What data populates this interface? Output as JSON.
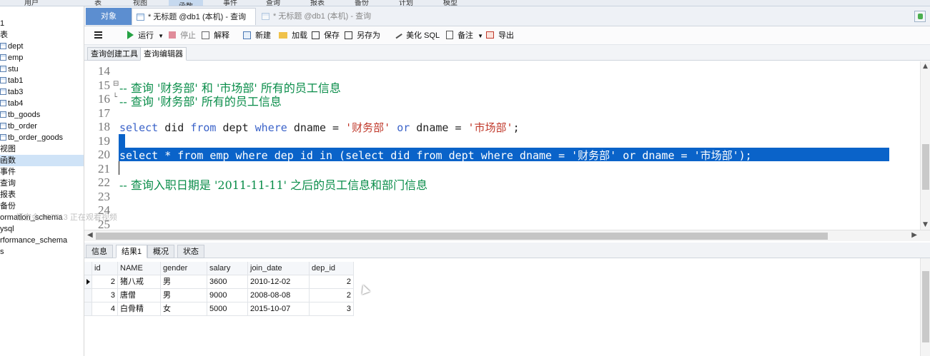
{
  "top_menu": [
    "用户",
    "表",
    "视图",
    "函数",
    "事件",
    "查询",
    "报表",
    "备份",
    "计划",
    "模型"
  ],
  "top_menu_active_index": 3,
  "tabs": {
    "objects_label": "对象",
    "active_tab": "* 无标题 @db1 (本机) - 查询",
    "inactive_tab": "* 无标题 @db1 (本机) - 查询"
  },
  "sidebar": {
    "items": [
      {
        "label": "1",
        "indent": 0,
        "icon": false
      },
      {
        "label": "表",
        "indent": 0,
        "icon": false
      },
      {
        "label": "dept",
        "indent": 1,
        "icon": true
      },
      {
        "label": "emp",
        "indent": 1,
        "icon": true
      },
      {
        "label": "stu",
        "indent": 1,
        "icon": true
      },
      {
        "label": "tab1",
        "indent": 1,
        "icon": true
      },
      {
        "label": "tab3",
        "indent": 1,
        "icon": true
      },
      {
        "label": "tab4",
        "indent": 1,
        "icon": true
      },
      {
        "label": "tb_goods",
        "indent": 1,
        "icon": true
      },
      {
        "label": "tb_order",
        "indent": 1,
        "icon": true
      },
      {
        "label": "tb_order_goods",
        "indent": 1,
        "icon": true
      },
      {
        "label": "视图",
        "indent": 0,
        "icon": false
      },
      {
        "label": "函数",
        "indent": 0,
        "icon": false,
        "selected": true
      },
      {
        "label": "事件",
        "indent": 0,
        "icon": false
      },
      {
        "label": "查询",
        "indent": 0,
        "icon": false
      },
      {
        "label": "报表",
        "indent": 0,
        "icon": false
      },
      {
        "label": "备份",
        "indent": 0,
        "icon": false
      },
      {
        "label": "ormation_schema",
        "indent": 0,
        "icon": false
      },
      {
        "label": "ysql",
        "indent": 0,
        "icon": false
      },
      {
        "label": "rformance_schema",
        "indent": 0,
        "icon": false
      },
      {
        "label": "s",
        "indent": 0,
        "icon": false
      }
    ],
    "watermark": "悟空会 987713 正在观看视频"
  },
  "toolbar": {
    "run": "运行",
    "stop": "停止",
    "explain": "解释",
    "new": "新建",
    "load": "加载",
    "save": "保存",
    "save_as": "另存为",
    "beautify": "美化 SQL",
    "comment": "备注",
    "export": "导出"
  },
  "subtabs": {
    "builder": "查询创建工具",
    "editor": "查询编辑器"
  },
  "editor": {
    "lines": [
      {
        "n": "14",
        "parts": []
      },
      {
        "n": "15",
        "parts": [
          {
            "t": "-- 查询 '财务部' 和 '市场部' 所有的员工信息",
            "c": "cm"
          }
        ],
        "fold": "⊟"
      },
      {
        "n": "16",
        "parts": [
          {
            "t": "-- 查询 '财务部' 所有的员工信息",
            "c": "cm"
          }
        ],
        "fold": "└"
      },
      {
        "n": "17",
        "parts": []
      },
      {
        "n": "18",
        "parts": [
          {
            "t": "select",
            "c": "kw"
          },
          {
            "t": " did ",
            "c": "pl"
          },
          {
            "t": "from",
            "c": "kw"
          },
          {
            "t": " dept ",
            "c": "pl"
          },
          {
            "t": "where",
            "c": "kw"
          },
          {
            "t": " dname = ",
            "c": "pl"
          },
          {
            "t": "'财务部'",
            "c": "st"
          },
          {
            "t": " ",
            "c": "pl"
          },
          {
            "t": "or",
            "c": "kw"
          },
          {
            "t": " dname = ",
            "c": "pl"
          },
          {
            "t": "'市场部'",
            "c": "st"
          },
          {
            "t": ";",
            "c": "pl"
          }
        ]
      },
      {
        "n": "19",
        "parts": []
      },
      {
        "n": "20",
        "parts": [
          {
            "t": "select * from emp where dep_id in (select did from dept where dname = '财务部' or dname = '市场部');",
            "c": "sel"
          }
        ]
      },
      {
        "n": "21",
        "parts": []
      },
      {
        "n": "22",
        "parts": [
          {
            "t": "-- 查询入职日期是 '2011-11-11' 之后的员工信息和部门信息",
            "c": "cm"
          }
        ]
      },
      {
        "n": "23",
        "parts": []
      },
      {
        "n": "24",
        "parts": []
      },
      {
        "n": "25",
        "parts": []
      }
    ]
  },
  "result_tabs": {
    "info": "信息",
    "result1": "结果1",
    "overview": "概况",
    "status": "状态"
  },
  "grid": {
    "columns": [
      "id",
      "NAME",
      "gender",
      "salary",
      "join_date",
      "dep_id"
    ],
    "rows": [
      [
        "2",
        "猪八戒",
        "男",
        "3600",
        "2010-12-02",
        "2"
      ],
      [
        "3",
        "唐僧",
        "男",
        "9000",
        "2008-08-08",
        "2"
      ],
      [
        "4",
        "白骨精",
        "女",
        "5000",
        "2015-10-07",
        "3"
      ]
    ]
  },
  "colors": {
    "accent": "#5c8ed0",
    "selection": "#0a63c9",
    "comment": "#0a8d4a",
    "keyword": "#3b63c9",
    "string": "#c0392b"
  }
}
